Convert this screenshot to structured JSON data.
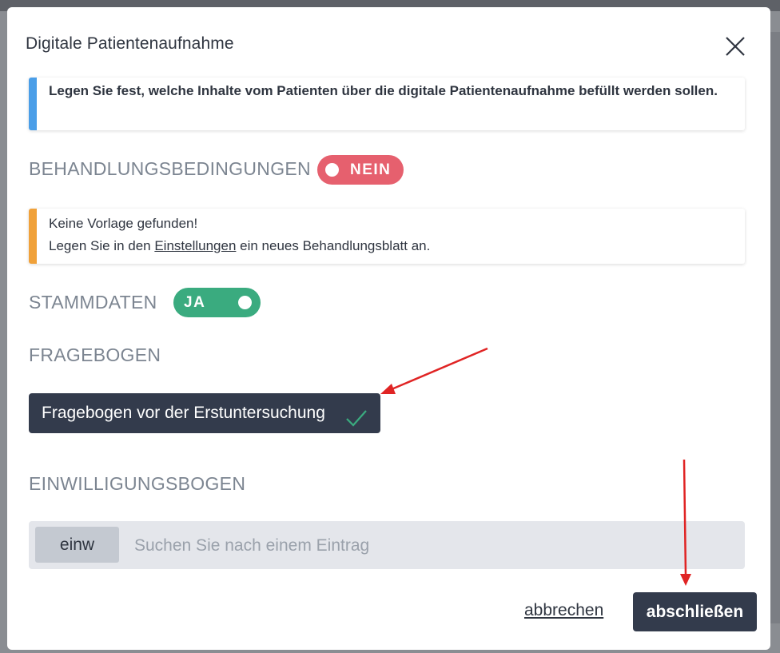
{
  "dialog": {
    "title": "Digitale Patientenaufnahme",
    "close_icon": "close-icon"
  },
  "intro_info": {
    "text": "Legen Sie fest, welche Inhalte vom Patienten über die digitale Patientenaufnahme befüllt werden sollen."
  },
  "sections": {
    "behandlungsbedingungen": {
      "label": "BEHANDLUNGSBEDINGUNGEN",
      "toggle_label": "NEIN",
      "toggle_color": "#e6606e"
    },
    "warning": {
      "line1": "Keine Vorlage gefunden!",
      "line2_prefix": "Legen Sie in den ",
      "line2_link": "Einstellungen",
      "line2_suffix": " ein neues Behandlungsblatt an."
    },
    "stammdaten": {
      "label": "STAMMDATEN",
      "toggle_label": "JA",
      "toggle_color": "#3aab7f"
    },
    "fragebogen": {
      "label": "FRAGEBOGEN",
      "selected_item": "Fragebogen vor der Erstuntersuchung",
      "check_icon": "check-icon"
    },
    "einwilligungsbogen": {
      "label": "EINWILLIGUNGSBOGEN",
      "search_tag": "einw",
      "search_placeholder": "Suchen Sie nach einem Eintrag"
    }
  },
  "footer": {
    "cancel_label": "abbrechen",
    "finish_label": "abschließen"
  },
  "colors": {
    "accent_dark": "#333b4c",
    "info_blue": "#4a9ee8",
    "warning_orange": "#f0a13a",
    "annotation_red": "#e02424"
  }
}
